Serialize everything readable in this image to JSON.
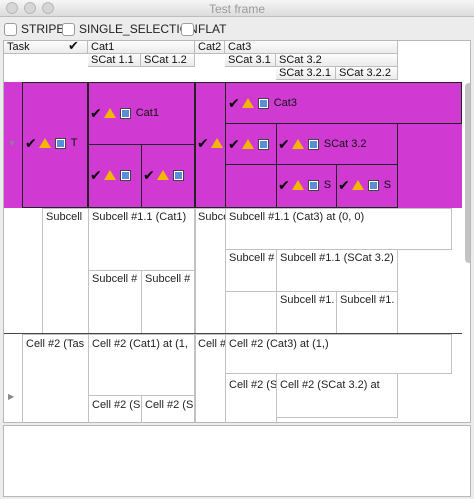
{
  "window": {
    "title": "Test frame"
  },
  "options": [
    {
      "label": "STRIPE",
      "checked": false
    },
    {
      "label": "SINGLE_SELECTION",
      "checked": false
    },
    {
      "label": "FLAT",
      "checked": false
    }
  ],
  "headers": {
    "task": "Task",
    "task_icon": "check-icon",
    "cat1": "Cat1",
    "cat2": "Cat2",
    "cat3": "Cat3",
    "scat11": "SCat 1.1",
    "scat12": "SCat 1.2",
    "scat31": "SCat 3.1",
    "scat32": "SCat 3.2",
    "scat321": "SCat 3.2.1",
    "scat322": "SCat 3.2.2"
  },
  "row1": {
    "task_label": "T",
    "cat1_label": "Cat1",
    "cat3_label": "Cat3",
    "scat32_label": "SCat 3.2",
    "scat321_label": "S",
    "scat322_label": "S",
    "icons": [
      "check-icon",
      "warning-icon",
      "checkbox-icon"
    ],
    "background": "#d03ad3"
  },
  "row2": {
    "subcell": "Subcell",
    "subcell_cat1": "Subcell #1.1 (Cat1)",
    "subcell_cat2": "Subce",
    "subcell_cat3": "Subcell #1.1 (Cat3) at (0, 0)",
    "subcell_scat31": "Subcell #",
    "subcell_scat32": "Subcell #1.1 (SCat 3.2)",
    "subcell_scat11": "Subcell #",
    "subcell_scat12": "Subcell #",
    "subcell_scat321": "Subcell #1.",
    "subcell_scat322": "Subcell #1."
  },
  "row3": {
    "task": "Cell #2 (Tas",
    "cat1": "Cell #2 (Cat1) at (1,",
    "cat2": "Cell #2",
    "cat3": "Cell #2 (Cat3) at (1,)",
    "scat31": "Cell #2 (S",
    "scat32": "Cell #2 (SCat 3.2) at",
    "scat11": "Cell #2 (S",
    "scat12": "Cell #2 (S"
  }
}
